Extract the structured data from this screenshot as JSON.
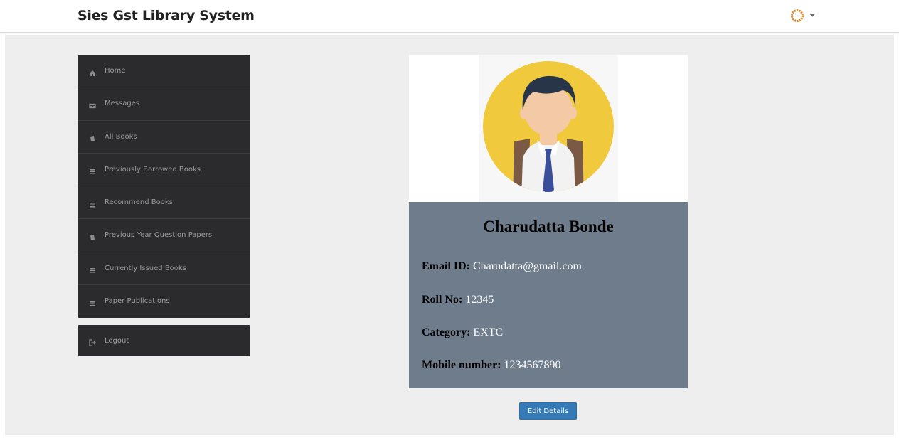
{
  "header": {
    "brand": "Sies Gst Library System",
    "user_icon": "sun-icon",
    "caret_icon": "caret-down-icon"
  },
  "sidebar": {
    "items": [
      {
        "label": "Home",
        "icon": "home-icon"
      },
      {
        "label": "Messages",
        "icon": "inbox-icon"
      },
      {
        "label": "All Books",
        "icon": "book-icon"
      },
      {
        "label": "Previously Borrowed Books",
        "icon": "list-icon"
      },
      {
        "label": "Recommend Books",
        "icon": "list-icon"
      },
      {
        "label": "Previous Year Question Papers",
        "icon": "book-icon"
      },
      {
        "label": "Currently Issued Books",
        "icon": "list-icon"
      },
      {
        "label": "Paper Publications",
        "icon": "list-icon"
      }
    ],
    "logout": {
      "label": "Logout",
      "icon": "logout-icon"
    }
  },
  "profile": {
    "avatar_icon": "student-avatar-icon",
    "name": "Charudatta Bonde",
    "fields": [
      {
        "key": "Email ID:",
        "value": "Charudatta@gmail.com"
      },
      {
        "key": "Roll No:",
        "value": "12345"
      },
      {
        "key": "Category:",
        "value": "EXTC"
      },
      {
        "key": "Mobile number:",
        "value": "1234567890"
      }
    ]
  },
  "actions": {
    "edit_label": "Edit Details"
  },
  "colors": {
    "sidebar_bg": "#2b2a2c",
    "details_bg": "#6f7c8c",
    "button_primary": "#337ab7",
    "page_bg": "#eeeeee"
  }
}
